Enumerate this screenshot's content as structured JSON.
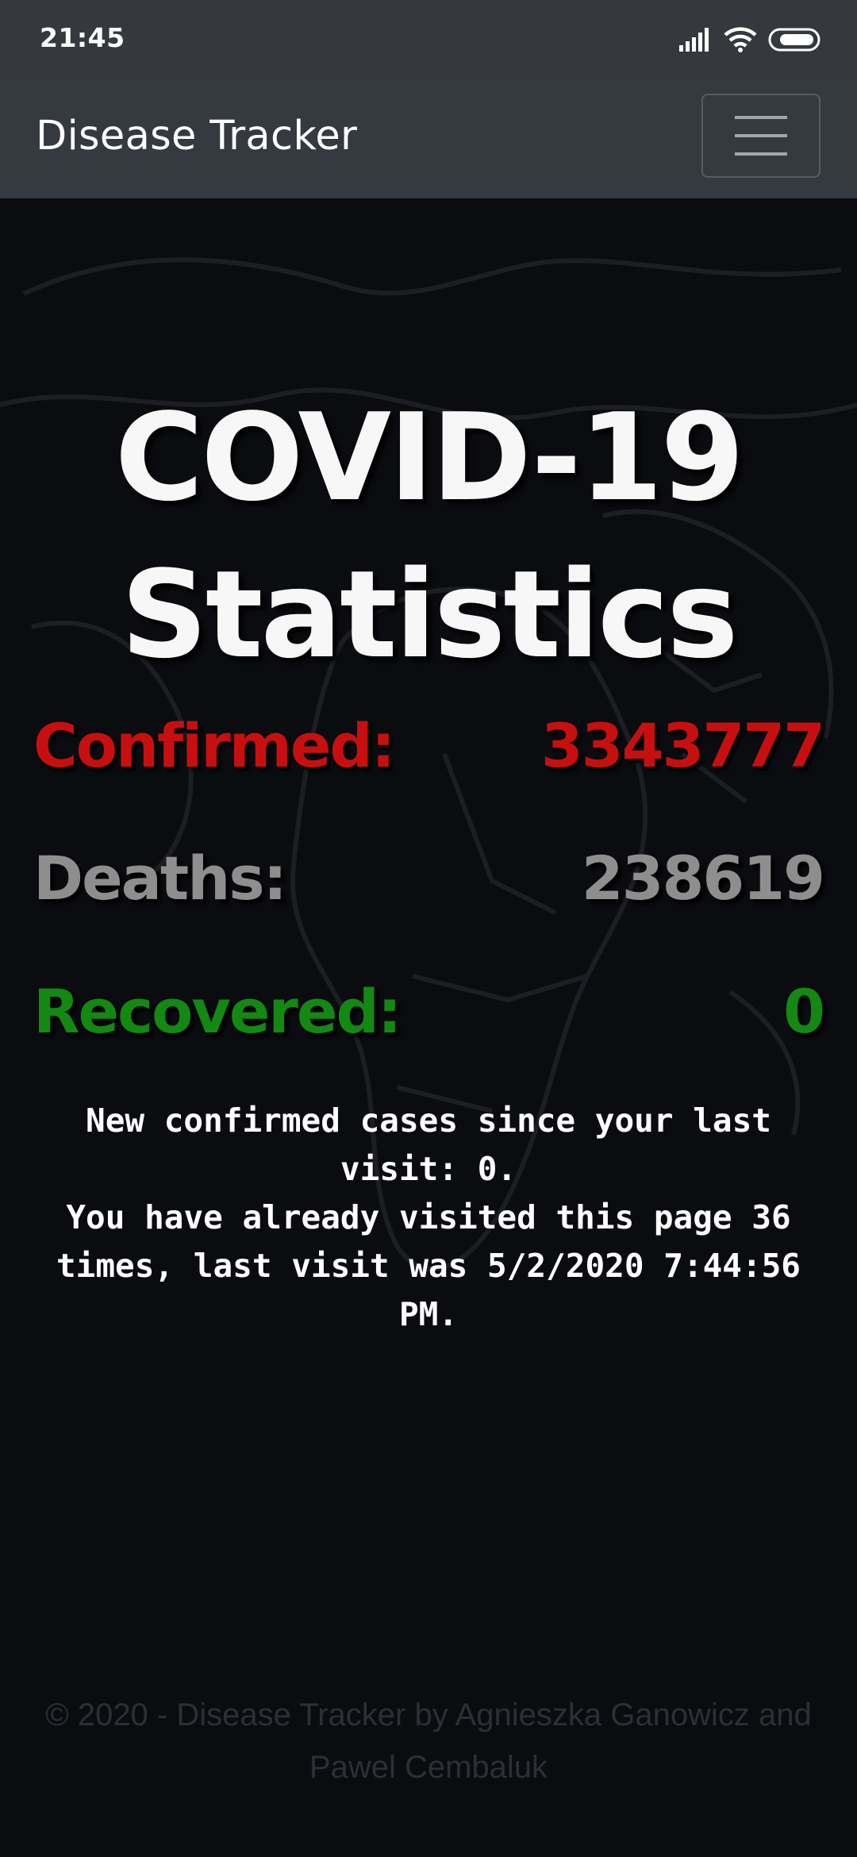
{
  "status_bar": {
    "time": "21:45",
    "icons": [
      "signal-icon",
      "wifi-icon",
      "battery-icon"
    ]
  },
  "navbar": {
    "brand": "Disease Tracker",
    "toggler_icon": "hamburger-menu-icon"
  },
  "main": {
    "headline": "COVID-19 Statistics",
    "stats": {
      "confirmed": {
        "label": "Confirmed:",
        "value": "3343777",
        "color": "#c80f0f"
      },
      "deaths": {
        "label": "Deaths:",
        "value": "238619",
        "color": "#8e8e8e"
      },
      "recovered": {
        "label": "Recovered:",
        "value": "0",
        "color": "#138812"
      }
    },
    "new_cases_text": "New confirmed cases since your last visit: 0.",
    "visits_text": "You have already visited this page 36 times, last visit was 5/2/2020 7:44:56 PM."
  },
  "footer": {
    "text": "© 2020 - Disease Tracker by Agnieszka Ganowicz and Pawel Cembaluk"
  },
  "colors": {
    "status_bar_bg": "#35383d",
    "navbar_bg": "#343a40",
    "page_bg": "#0b0c10"
  }
}
